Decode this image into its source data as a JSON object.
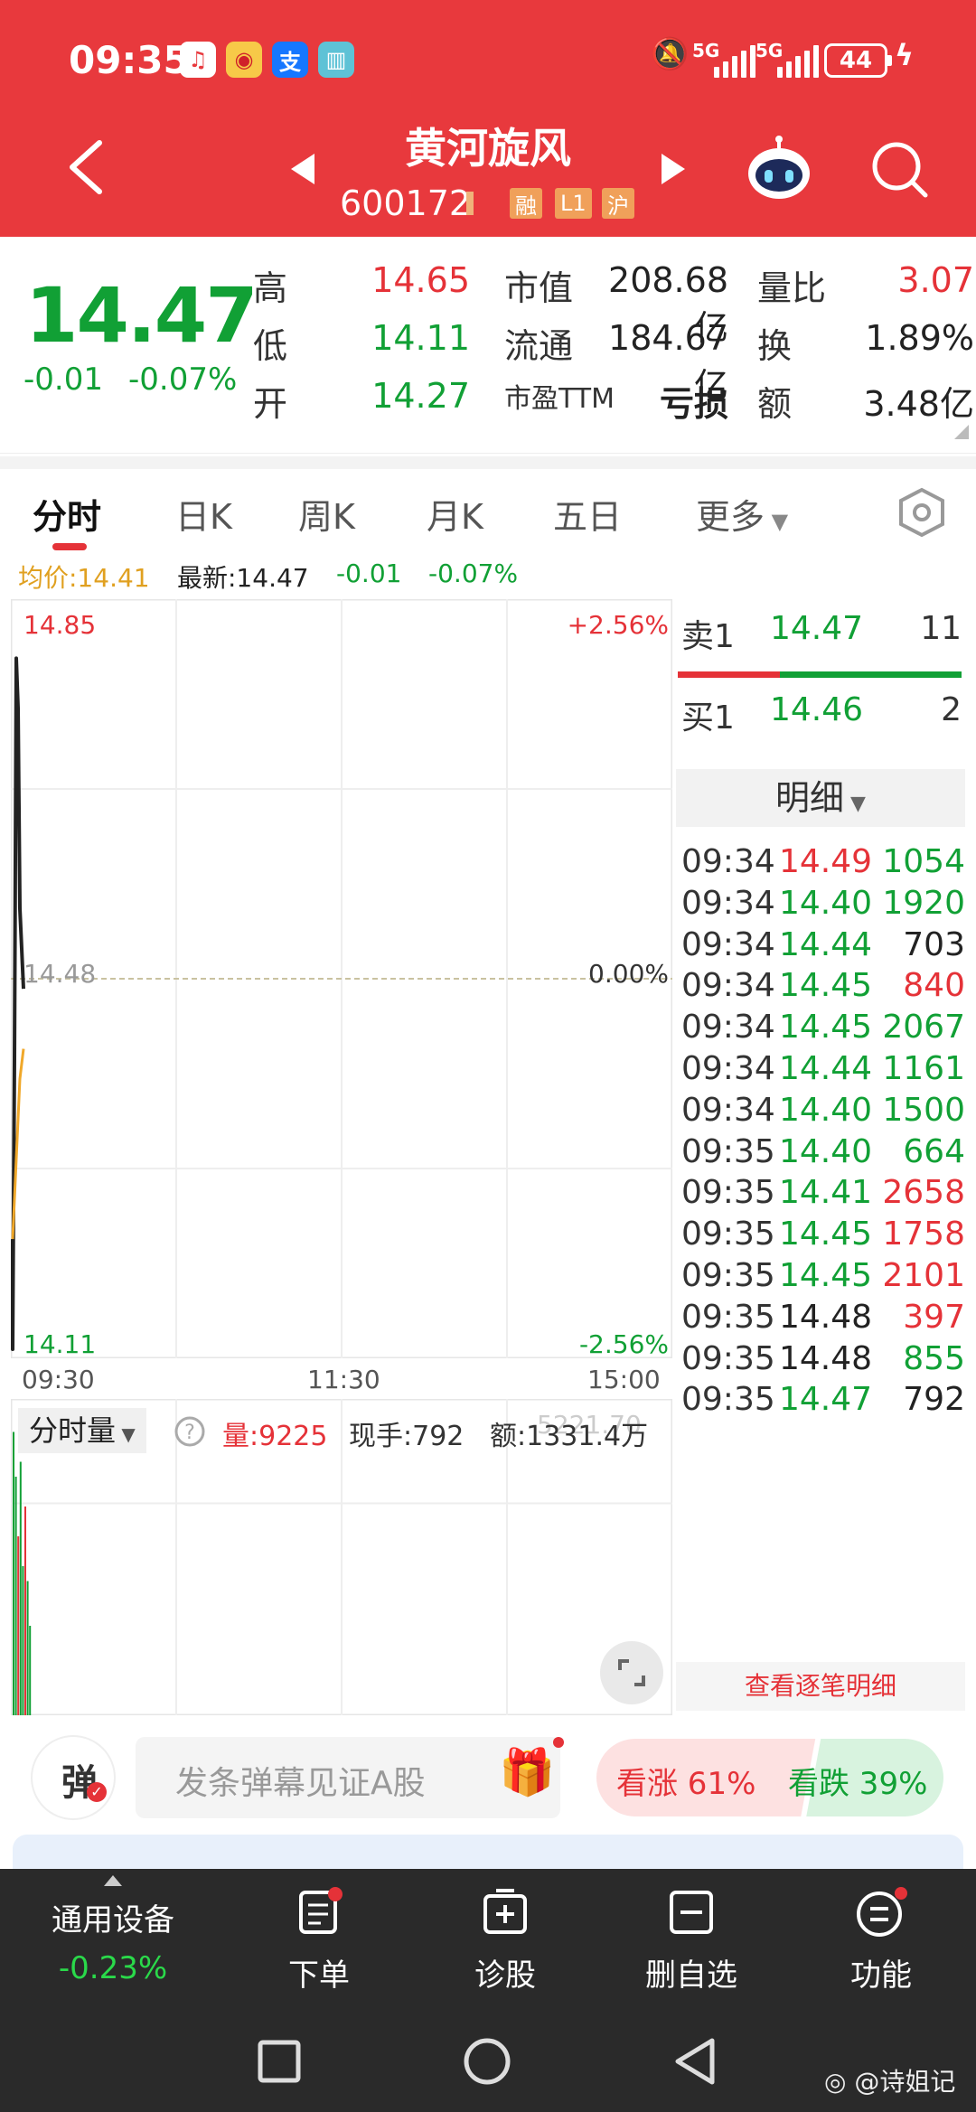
{
  "status": {
    "time": "09:35",
    "net1": "5G",
    "net2": "5G",
    "battery": "44"
  },
  "header": {
    "title": "黄河旋风",
    "code": "600172",
    "tags": [
      "融",
      "L1",
      "沪"
    ]
  },
  "quote": {
    "price": "14.47",
    "change": "-0.01",
    "change_pct": "-0.07%",
    "rows": [
      {
        "l1": "高",
        "v1": "14.65",
        "l2": "市值",
        "v2": "208.68亿",
        "l3": "量比",
        "v3": "3.07"
      },
      {
        "l1": "低",
        "v1": "14.11",
        "l2": "流通",
        "v2": "184.67亿",
        "l3": "换",
        "v3": "1.89%"
      },
      {
        "l1": "开",
        "v1": "14.27",
        "l2": "市盈TTM",
        "v2": "亏损",
        "l3": "额",
        "v3": "3.48亿"
      }
    ]
  },
  "tabs": [
    "分时",
    "日K",
    "周K",
    "月K",
    "五日",
    "更多"
  ],
  "infoline": {
    "avg": "均价:14.41",
    "latest": "最新:14.47",
    "change": "-0.01",
    "change_pct": "-0.07%"
  },
  "chart_data": {
    "type": "line",
    "ylim": [
      14.11,
      14.85
    ],
    "y_ticks": [
      "14.85",
      "14.48",
      "14.11"
    ],
    "pct_ticks": [
      "+2.56%",
      "0.00%",
      "-2.56%"
    ],
    "x_ticks": [
      "09:30",
      "11:30",
      "15:00"
    ],
    "series": [
      {
        "values": [
          14.22,
          14.11,
          14.4,
          14.8,
          14.75,
          14.55,
          14.47
        ]
      },
      {
        "values": [
          14.22,
          14.3,
          14.38,
          14.41
        ]
      }
    ],
    "volume_values": [
      0.95,
      0.8,
      0.6,
      0.85,
      0.5,
      0.7,
      0.45,
      0.3
    ]
  },
  "book": {
    "sell": {
      "label": "卖1",
      "price": "14.47",
      "vol": "11"
    },
    "buy": {
      "label": "买1",
      "price": "14.46",
      "vol": "2"
    },
    "detail_label": "明细",
    "trades": [
      {
        "t": "09:34",
        "p": "14.49",
        "v": "1054",
        "pc": "red",
        "vc": "green"
      },
      {
        "t": "09:34",
        "p": "14.40",
        "v": "1920",
        "pc": "green",
        "vc": "green"
      },
      {
        "t": "09:34",
        "p": "14.44",
        "v": "703",
        "pc": "green",
        "vc": "dark"
      },
      {
        "t": "09:34",
        "p": "14.45",
        "v": "840",
        "pc": "green",
        "vc": "red"
      },
      {
        "t": "09:34",
        "p": "14.45",
        "v": "2067",
        "pc": "green",
        "vc": "green"
      },
      {
        "t": "09:34",
        "p": "14.44",
        "v": "1161",
        "pc": "green",
        "vc": "green"
      },
      {
        "t": "09:34",
        "p": "14.40",
        "v": "1500",
        "pc": "green",
        "vc": "green"
      },
      {
        "t": "09:35",
        "p": "14.40",
        "v": "664",
        "pc": "green",
        "vc": "green"
      },
      {
        "t": "09:35",
        "p": "14.41",
        "v": "2658",
        "pc": "green",
        "vc": "red"
      },
      {
        "t": "09:35",
        "p": "14.45",
        "v": "1758",
        "pc": "green",
        "vc": "red"
      },
      {
        "t": "09:35",
        "p": "14.45",
        "v": "2101",
        "pc": "green",
        "vc": "red"
      },
      {
        "t": "09:35",
        "p": "14.48",
        "v": "397",
        "pc": "dark",
        "vc": "red"
      },
      {
        "t": "09:35",
        "p": "14.48",
        "v": "855",
        "pc": "dark",
        "vc": "green"
      },
      {
        "t": "09:35",
        "p": "14.47",
        "v": "792",
        "pc": "green",
        "vc": "dark"
      }
    ],
    "more_link": "查看逐笔明细"
  },
  "volume": {
    "selector": "分时量",
    "vol": "量:9225",
    "now": "现手:792",
    "amount": "额:1331.4万",
    "ghost": "5221.70"
  },
  "danmaku": {
    "badge": "弹",
    "placeholder": "发条弹幕见证A股",
    "up": "看涨 61%",
    "down": "看跌 39%",
    "up_pct": 61
  },
  "bottomnav": {
    "index_name": "通用设备",
    "index_change": "-0.23%",
    "items": [
      "下单",
      "诊股",
      "删自选",
      "功能"
    ]
  },
  "colors": {
    "header": "#e8393d",
    "up": "#e53238",
    "down": "#11a035",
    "nav": "#2a2a2a"
  },
  "watermark": "@诗姐记"
}
